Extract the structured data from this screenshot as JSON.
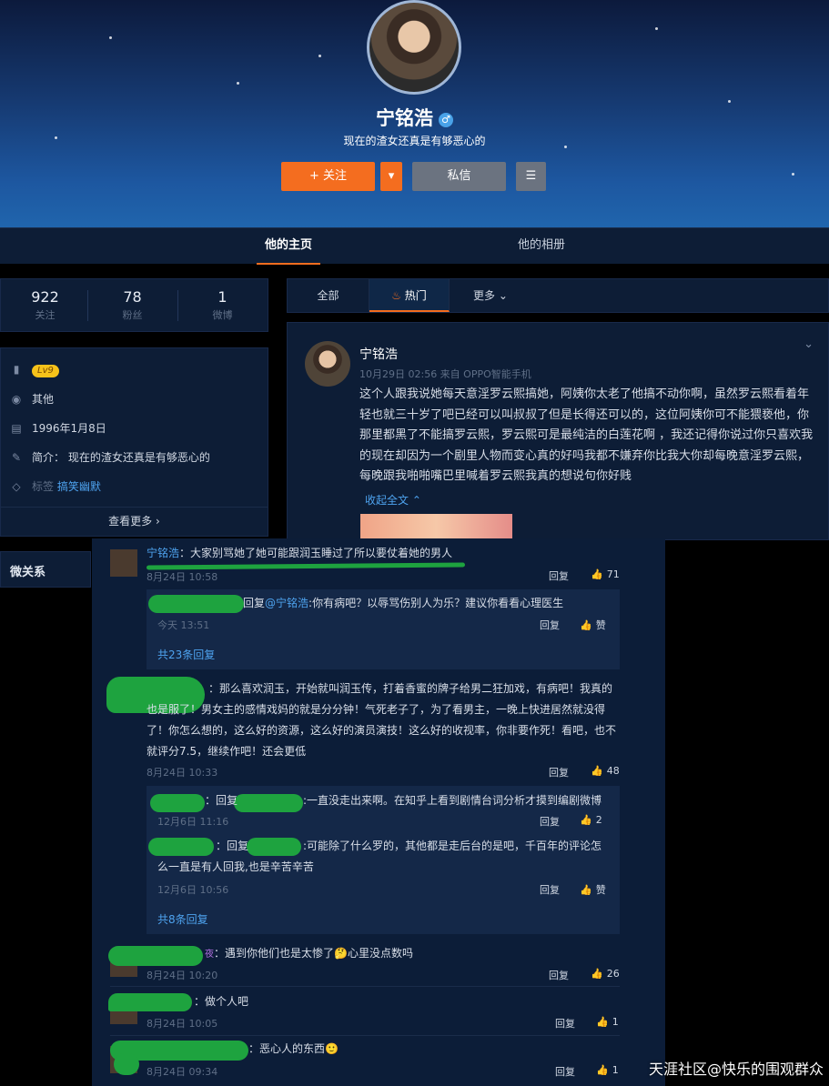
{
  "profile": {
    "name": "宁铭浩",
    "gender_symbol": "♂",
    "bio": "现在的渣女还真是有够恶心的",
    "follow_label": "+ 关注",
    "message_label": "私信"
  },
  "tabs": {
    "home": "他的主页",
    "album": "他的相册"
  },
  "stats": [
    {
      "num": "922",
      "label": "关注"
    },
    {
      "num": "78",
      "label": "粉丝"
    },
    {
      "num": "1",
      "label": "微博"
    }
  ],
  "info": {
    "level": "Lv9",
    "location": "其他",
    "birthday": "1996年1月8日",
    "intro_label": "简介：",
    "intro": "现在的渣女还真是有够恶心的",
    "tag_label": "标签",
    "tag": "搞笑幽默",
    "more": "查看更多"
  },
  "micro_title": "微关系",
  "feed_tabs": {
    "all": "全部",
    "hot": "热门",
    "more": "更多"
  },
  "post": {
    "name": "宁铭浩",
    "meta": "10月29日 02:56 来自 OPPO智能手机",
    "text": "这个人跟我说她每天意淫罗云熙搞她，阿姨你太老了他搞不动你啊，虽然罗云熙看着年轻也就三十岁了吧已经可以叫叔叔了但是长得还可以的，这位阿姨你可不能猥亵他，你那里都黑了不能搞罗云熙，罗云熙可是最纯洁的白莲花啊 ，我还记得你说过你只喜欢我的现在却因为一个剧里人物而变心真的好吗我都不嫌弃你比我大你却每晚意淫罗云熙，每晚跟我啪啪嘴巴里喊着罗云熙我真的想说句你好贱",
    "collapse": "收起全文"
  },
  "comments": {
    "reply_label": "回复",
    "praise_label": "赞",
    "c1": {
      "name": "宁铭浩",
      "text": "：大家别骂她了她可能跟润玉睡过了所以要仗着她的男人",
      "time": "8月24日 10:58",
      "likes": "71"
    },
    "c1_reply": {
      "prefix": "回复",
      "mention": "@宁铭浩",
      "text": ":你有病吧？以辱骂伤别人为乐？建议你看看心理医生",
      "time": "今天 13:51",
      "more": "共23条回复"
    },
    "c2": {
      "text": "：那么喜欢润玉，开始就叫润玉传，打着香蜜的牌子给男二狂加戏，有病吧！我真的也是服了！男女主的感情戏妈的就是分分钟！气死老子了，为了看男主，一晚上快进居然就没得了！你怎么想的，这么好的资源，这么好的演员演技！这么好的收视率，你非要作死！看吧，也不就评分7.5，继续作吧！还会更低",
      "time": "8月24日 10:33",
      "likes": "48"
    },
    "c2_r1": {
      "prefix": "：回复",
      "text": ":一直没走出来啊。在知乎上看到剧情台词分析才摸到编剧微博",
      "time": "12月6日 11:16",
      "likes": "2"
    },
    "c2_r2": {
      "prefix": "：回复",
      "text": ":可能除了什么罗的，其他都是走后台的是吧，千百年的评论怎么一直是有人回我,也是辛苦辛苦",
      "time": "12月6日 10:56",
      "more": "共8条回复"
    },
    "c3": {
      "badge": "夜",
      "text": "：遇到你他们也是太惨了",
      "text2": "心里没点数吗",
      "time": "8月24日 10:20",
      "likes": "26"
    },
    "c4": {
      "text": "：做个人吧",
      "time": "8月24日 10:05",
      "likes": "1"
    },
    "c5": {
      "text": "：恶心人的东西",
      "time": "8月24日 09:34",
      "likes": "1"
    }
  },
  "watermark": "天涯社区@快乐的围观群众",
  "colors": {
    "accent": "#f46d1f",
    "link": "#4ea3ef",
    "panel": "#0d1d36",
    "redaction": "#1ea33f"
  }
}
